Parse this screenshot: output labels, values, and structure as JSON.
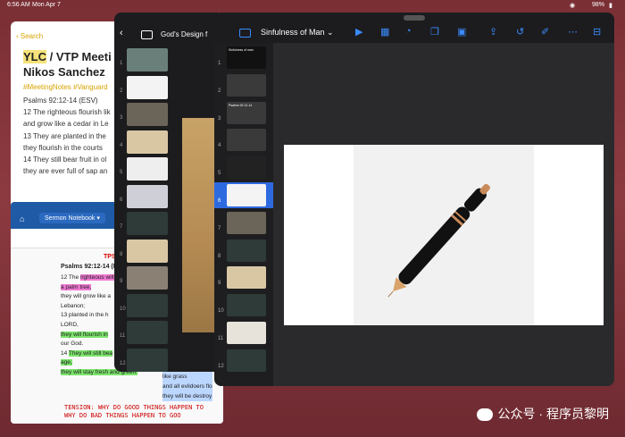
{
  "status": {
    "time": "6:56 AM",
    "date": "Mon Apr 7",
    "battery": "98%"
  },
  "notes_app": {
    "search_label": "Search",
    "title_line1_hl": "YLC",
    "title_line1_rest": " / VTP Meeti",
    "title_line2": "Nikos Sanchez",
    "tags": "#MeetingNotes #Vanguard",
    "body": [
      "Psalms 92:12-14 (ESV)",
      "12 The righteous flourish lik",
      "and grow like a cedar in Le",
      "13 They are planted in the",
      "they flourish in the courts",
      "14 They still bear fruit in ol",
      "they are ever full of sap an"
    ]
  },
  "sermon_app": {
    "notebook": "Sermon Notebook",
    "title": "TPS",
    "psalm_ref": "Psalms 92:12-14 (NIV)",
    "lines": [
      {
        "prefix": "12 The ",
        "hl": "righteous will",
        "after": "",
        "hl_class": "hl-pink"
      },
      {
        "prefix": "",
        "hl": "a palm tree,",
        "after": "",
        "hl_class": "hl-pink"
      },
      {
        "prefix": "they will grow like a",
        "hl": "",
        "after": "",
        "hl_class": ""
      },
      {
        "prefix": "Lebanon;",
        "hl": "",
        "after": "",
        "hl_class": ""
      },
      {
        "prefix": "13 planted in the h",
        "hl": "",
        "after": "",
        "hl_class": ""
      },
      {
        "prefix": "LORD,",
        "hl": "",
        "after": "",
        "hl_class": ""
      },
      {
        "prefix": "",
        "hl": "they will flourish in",
        "after": "",
        "hl_class": "hl-green"
      },
      {
        "prefix": "our God.",
        "hl": "",
        "after": "",
        "hl_class": ""
      },
      {
        "prefix": "14 ",
        "hl": "They will still bea",
        "after": "",
        "hl_class": "hl-green"
      },
      {
        "prefix": "",
        "hl": "age,",
        "after": "",
        "hl_class": "hl-green"
      },
      {
        "prefix": "",
        "hl": "they will stay fresh and green.",
        "after": "",
        "hl_class": "hl-green"
      }
    ],
    "right_lines": [
      "like grass",
      "and all evildoers flo",
      "they will be destroy"
    ],
    "tension": [
      "TENSION: WHY DO GOOD THINGS HAPPEN TO",
      "WHY DO BAD THINGS HAPPEN TO GOO"
    ]
  },
  "gods_design": {
    "doc_name": "God's Design f",
    "slide_numbers": [
      "1",
      "2",
      "3",
      "4",
      "5",
      "6",
      "7",
      "8",
      "9",
      "10",
      "11",
      "12"
    ]
  },
  "sinfulness": {
    "doc_name": "Sinfulness of Man",
    "slide_numbers": [
      "1",
      "2",
      "3",
      "4",
      "5",
      "6",
      "7",
      "8",
      "9",
      "10",
      "11",
      "12"
    ],
    "selected": "6",
    "thumb_titles": [
      "Sinfulness of man",
      "",
      "Psalms 92:12-14",
      "",
      "",
      "",
      "",
      "",
      "",
      "",
      "",
      ""
    ]
  },
  "watermark": "公众号 · 程序员黎明",
  "colors": {
    "keynote_blue": "#3a8bff",
    "note_yellow": "#d8a300",
    "sermon_blue": "#1f5aa6"
  }
}
